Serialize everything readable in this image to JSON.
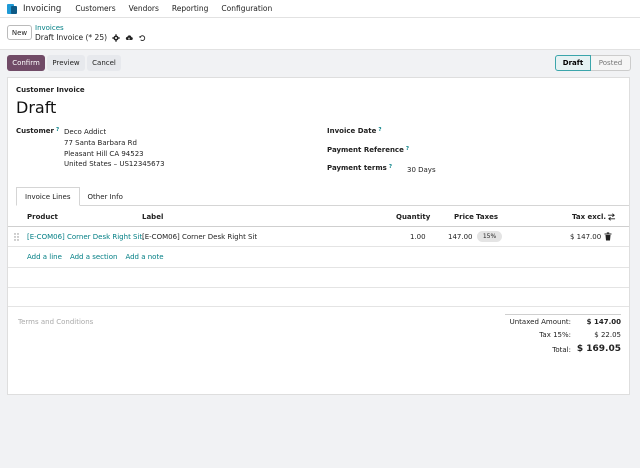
{
  "app": {
    "name": "Invoicing",
    "menu": [
      "Customers",
      "Vendors",
      "Reporting",
      "Configuration"
    ]
  },
  "control": {
    "new_label": "New",
    "breadcrumb_parent": "Invoices",
    "breadcrumb_current": "Draft Invoice (* 25)"
  },
  "actions": {
    "confirm": "Confirm",
    "preview": "Preview",
    "cancel": "Cancel"
  },
  "status": {
    "stages": [
      "Draft",
      "Posted"
    ],
    "active": "Draft"
  },
  "form": {
    "doc_type": "Customer Invoice",
    "doc_name": "Draft",
    "customer_label": "Customer",
    "customer_sup": "?",
    "customer_lines": [
      "Deco Addict",
      "77 Santa Barbara Rd",
      "Pleasant Hill CA 94523",
      "United States – US12345673"
    ],
    "invoice_date_label": "Invoice Date",
    "invoice_date_sup": "?",
    "payment_ref_label": "Payment Reference",
    "payment_ref_sup": "?",
    "payment_terms_label": "Payment terms",
    "payment_terms_sup": "?",
    "payment_terms_value": "30 Days"
  },
  "tabs": [
    "Invoice Lines",
    "Other Info"
  ],
  "lines": {
    "headers": {
      "product": "Product",
      "label": "Label",
      "quantity": "Quantity",
      "price": "Price",
      "taxes": "Taxes",
      "tax_excl": "Tax excl."
    },
    "rows": [
      {
        "product": "[E-COM06] Corner Desk Right Sit.",
        "label": "[E-COM06] Corner Desk Right Sit",
        "quantity": "1.00",
        "price": "147.00",
        "tax": "15%",
        "subtotal": "$ 147.00"
      }
    ],
    "add_line": "Add a line",
    "add_section": "Add a section",
    "add_note": "Add a note"
  },
  "footer": {
    "terms_placeholder": "Terms and Conditions",
    "untaxed_label": "Untaxed Amount:",
    "untaxed_value": "$ 147.00",
    "tax_label": "Tax 15%:",
    "tax_value": "$ 22.05",
    "total_label": "Total:",
    "total_value": "$ 169.05"
  },
  "colors": {
    "primary": "#714b67",
    "link": "#017e84",
    "stage_active_border": "#3ba5ab"
  }
}
